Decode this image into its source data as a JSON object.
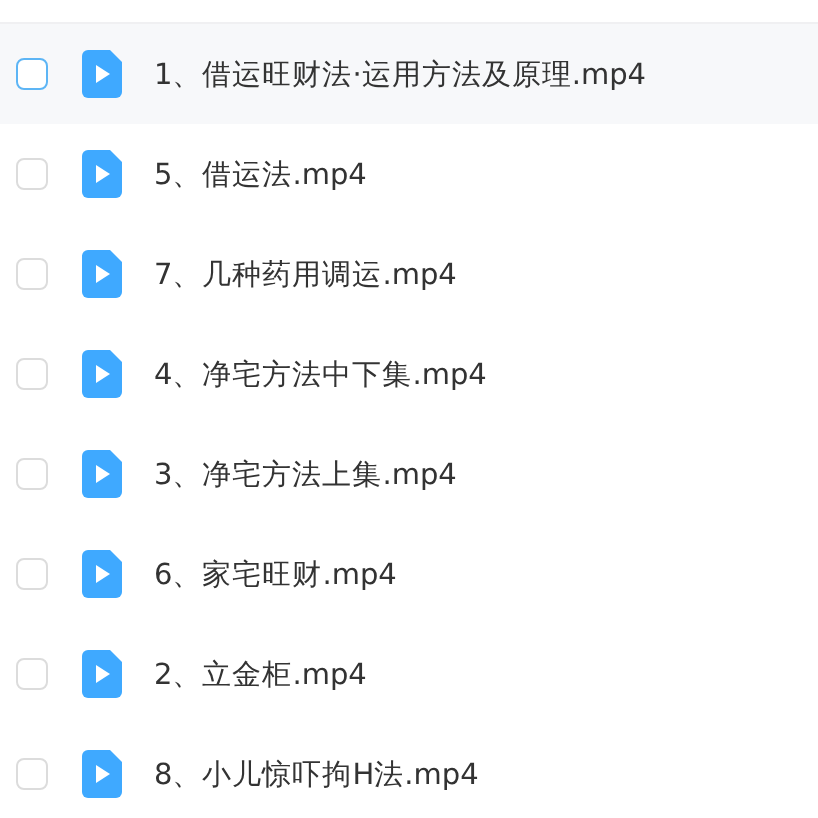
{
  "files": [
    {
      "name": "1、借运旺财法·运用方法及原理.mp4",
      "highlighted": true,
      "checked": false
    },
    {
      "name": "5、借运法.mp4",
      "highlighted": false,
      "checked": false
    },
    {
      "name": "7、几种药用调运.mp4",
      "highlighted": false,
      "checked": false
    },
    {
      "name": "4、净宅方法中下集.mp4",
      "highlighted": false,
      "checked": false
    },
    {
      "name": "3、净宅方法上集.mp4",
      "highlighted": false,
      "checked": false
    },
    {
      "name": "6、家宅旺财.mp4",
      "highlighted": false,
      "checked": false
    },
    {
      "name": "2、立金柜.mp4",
      "highlighted": false,
      "checked": false
    },
    {
      "name": "8、小儿惊吓拘H法.mp4",
      "highlighted": false,
      "checked": false
    }
  ]
}
